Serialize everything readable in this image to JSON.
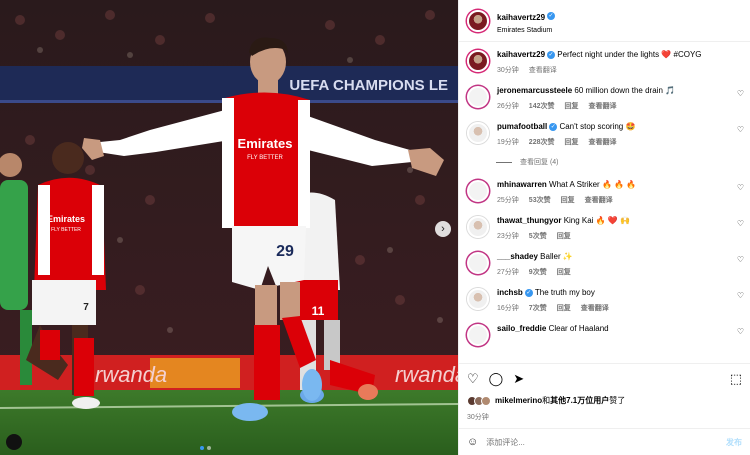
{
  "post": {
    "username": "kaihavertz29",
    "location": "Emirates Stadium",
    "caption_text": "Perfect night under the lights ❤️ #COYG",
    "caption_time": "30分钟",
    "caption_translate": "查看翻译"
  },
  "photo": {
    "banner_text": "UEFA CHAMPIONS LE",
    "sponsor_text": "Emirates",
    "sponsor_sub": "FLY BETTER",
    "shirt_number": "29",
    "teammate_sponsor": "Emirates",
    "teammate_sponsor_sub": "FLY BETTER",
    "teammate_number": "7",
    "back_number": "11",
    "ad_text": "rwanda"
  },
  "comments": [
    {
      "user": "jeronemarcussteele",
      "text": "60 million down the drain 🎵",
      "time": "26分钟",
      "likes": "142次赞",
      "reply": "回复",
      "translate": "查看翻译",
      "verified": false
    },
    {
      "user": "pumafootball",
      "text": "Can't stop scoring 🤩",
      "time": "19分钟",
      "likes": "228次赞",
      "reply": "回复",
      "translate": "查看翻译",
      "verified": true
    },
    {
      "user": "mhinawarren",
      "text": "What A Striker 🔥 🔥 🔥",
      "time": "25分钟",
      "likes": "53次赞",
      "reply": "回复",
      "translate": "查看翻译",
      "verified": false
    },
    {
      "user": "thawat_thungyor",
      "text": "King Kai 🔥 ❤️ 🙌",
      "time": "23分钟",
      "likes": "5次赞",
      "reply": "回复",
      "translate": "",
      "verified": false
    },
    {
      "user": "___shadey",
      "text": "Baller ✨",
      "time": "27分钟",
      "likes": "9次赞",
      "reply": "回复",
      "translate": "",
      "verified": false
    },
    {
      "user": "inchsb",
      "text": "The truth my boy",
      "time": "16分钟",
      "likes": "7次赞",
      "reply": "回复",
      "translate": "查看翻译",
      "verified": true
    },
    {
      "user": "sailo_freddie",
      "text": "Clear of Haaland",
      "time": "",
      "likes": "",
      "reply": "",
      "translate": "",
      "verified": false
    }
  ],
  "more_replies": "查看回复 (4)",
  "likes_line": {
    "user": "mikelmerino",
    "rest": "和其他7.1万位用户赞了",
    "mid": "和",
    "others": "其他7.1万位用户",
    "tail": "赞了"
  },
  "post_time": "30分钟",
  "compose": {
    "placeholder": "添加评论...",
    "post_label": "发布"
  },
  "icons": {
    "heart": "heart-icon",
    "comment": "comment-icon",
    "share": "share-icon",
    "save": "bookmark-icon",
    "emoji": "emoji-icon"
  },
  "colors": {
    "verified": "#3897f0",
    "link": "#00376b",
    "arsenal_red": "#db0007"
  }
}
